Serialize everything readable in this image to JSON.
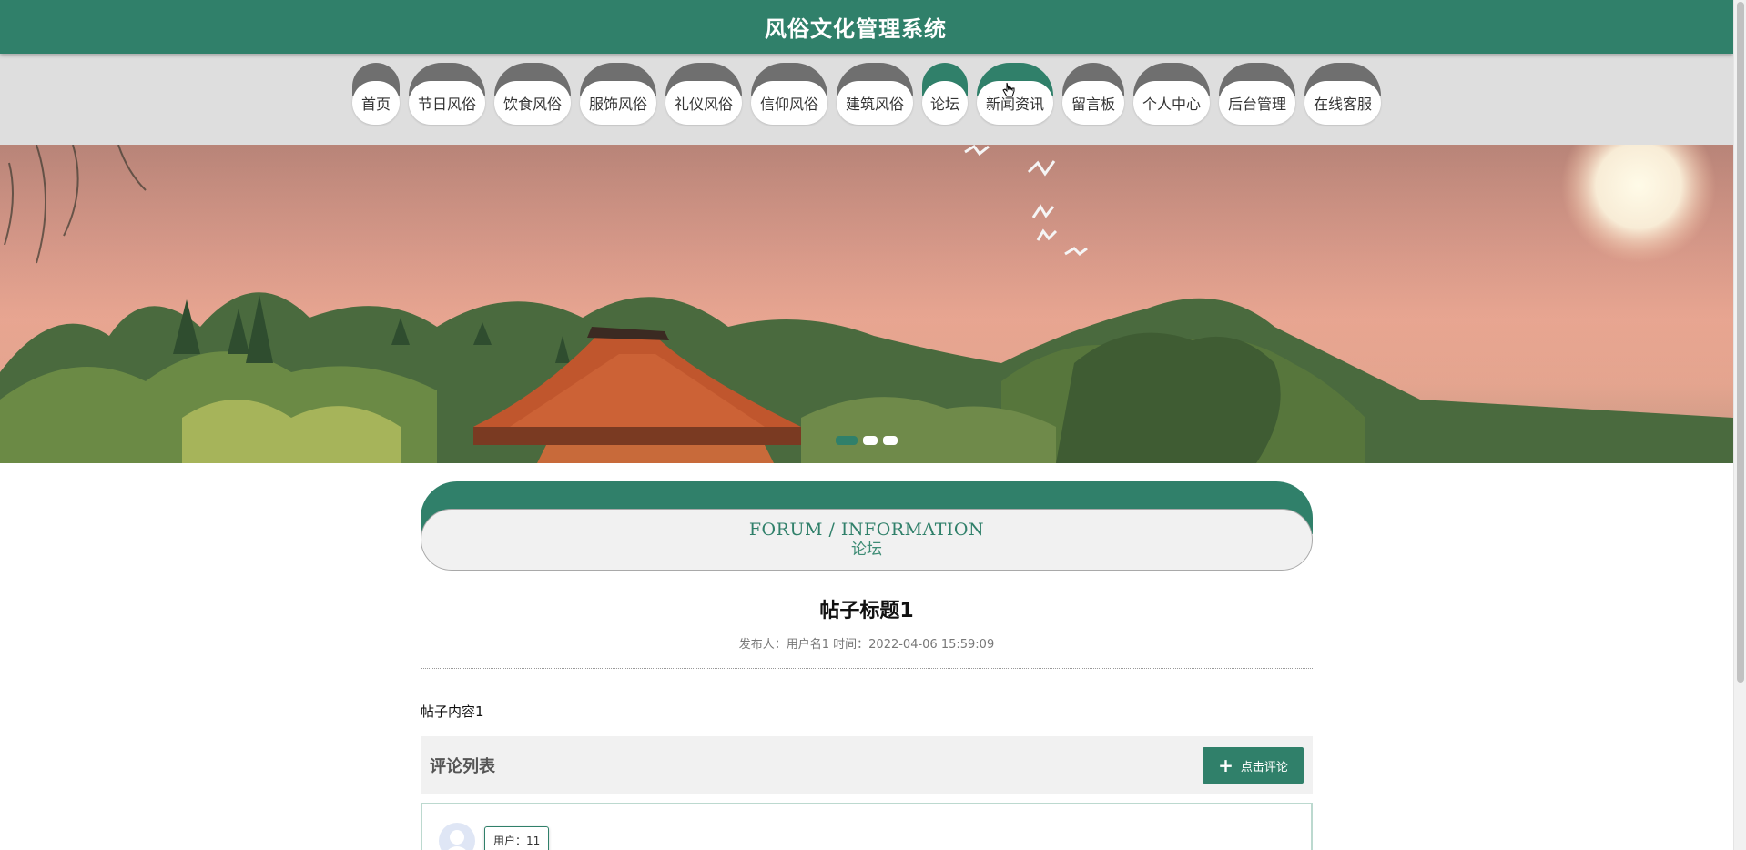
{
  "header": {
    "title": "风俗文化管理系统"
  },
  "nav": {
    "items": [
      {
        "label": "首页",
        "w": 52
      },
      {
        "label": "节日风俗",
        "w": 84
      },
      {
        "label": "饮食风俗",
        "w": 84
      },
      {
        "label": "服饰风俗",
        "w": 84
      },
      {
        "label": "礼仪风俗",
        "w": 84
      },
      {
        "label": "信仰风俗",
        "w": 84
      },
      {
        "label": "建筑风俗",
        "w": 84
      },
      {
        "label": "论坛",
        "w": 50
      },
      {
        "label": "新闻资讯",
        "w": 84
      },
      {
        "label": "留言板",
        "w": 68
      },
      {
        "label": "个人中心",
        "w": 84
      },
      {
        "label": "后台管理",
        "w": 84
      },
      {
        "label": "在线客服",
        "w": 84
      }
    ],
    "active_index": 7,
    "hover_index": 8
  },
  "banner": {
    "slides": 3,
    "active_slide": 0
  },
  "section": {
    "title_en": "FORUM / INFORMATION",
    "title_cn": "论坛"
  },
  "post": {
    "title": "帖子标题1",
    "meta": "发布人：用户名1 时间：2022-04-06 15:59:09",
    "content": "帖子内容1"
  },
  "comments": {
    "title": "评论列表",
    "add_label": "点击评论",
    "items": [
      {
        "user": "用户：11"
      }
    ]
  },
  "colors": {
    "primary": "#30806a",
    "nav_cap": "#6f6f6f",
    "nav_bg": "#dedede"
  }
}
